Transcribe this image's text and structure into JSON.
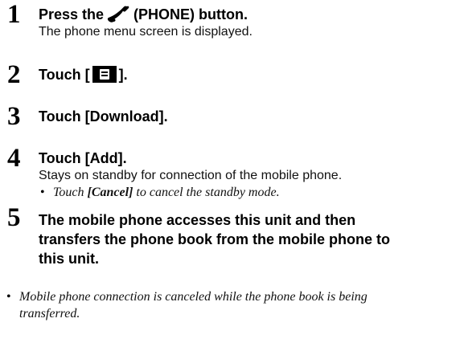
{
  "steps": [
    {
      "number": "1",
      "heading_before": "Press the",
      "icon": "phone-handset-icon",
      "heading_after": "(PHONE) button.",
      "body": "The phone menu screen is displayed."
    },
    {
      "number": "2",
      "heading_before": "Touch [",
      "icon": "phone-book-icon",
      "heading_after": "]."
    },
    {
      "number": "3",
      "heading": "Touch [Download]."
    },
    {
      "number": "4",
      "heading": "Touch [Add].",
      "body": "Stays on standby for connection of the mobile phone.",
      "note": "Touch [Cancel] to cancel the standby mode.",
      "note_parts": [
        "Touch ",
        "[Cancel]",
        " to cancel the standby mode."
      ]
    },
    {
      "number": "5",
      "heading_lines": [
        "The mobile phone accesses this unit and then",
        "transfers the phone book from the mobile phone to",
        "this unit."
      ]
    }
  ],
  "footnote": {
    "lines": [
      "Mobile phone connection is canceled while the phone book is being",
      "transferred."
    ]
  }
}
